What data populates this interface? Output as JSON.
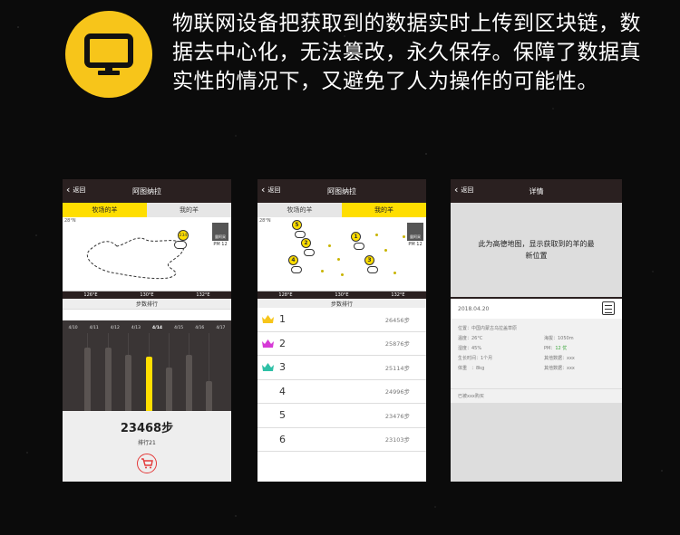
{
  "header": {
    "icon": "monitor-icon",
    "text": "物联网设备把获取到的数据实时上传到区块链，数据去中心化，无法篡改，永久保存。保障了数据真实性的情况下，又避免了人为操作的可能性。"
  },
  "colors": {
    "accent": "#ffde00",
    "dark": "#2a2020",
    "background": "#0b0b0b"
  },
  "phone1": {
    "back": "返回",
    "title": "阿图纳拉",
    "tabs": [
      "牧场的羊",
      "我的羊"
    ],
    "coord_top": "28°N",
    "stat_label": "量阿采",
    "pm": "PM 12",
    "marker": "234",
    "scale": [
      "126°E",
      "130°E",
      "132°E"
    ],
    "rank_title": "步数排行",
    "dates": [
      "4/10",
      "4/11",
      "4/12",
      "4/13",
      "4/14",
      "4/15",
      "4/16",
      "4/17"
    ],
    "selected_date": "4/14",
    "bar_values": [
      0.7,
      0.7,
      0.62,
      0.6,
      0.48,
      0.62,
      0.33
    ],
    "steps": "23468步",
    "rank": "排行21"
  },
  "phone2": {
    "back": "返回",
    "title": "阿图纳拉",
    "tabs": [
      "牧场的羊",
      "我的羊"
    ],
    "coord_top": "28°N",
    "stat_label": "量阿采",
    "pm": "PM 12",
    "markers": [
      "5",
      "2",
      "4",
      "1",
      "3"
    ],
    "scale": [
      "128°E",
      "130°E",
      "132°E"
    ],
    "rank_title": "步数排行",
    "rows": [
      {
        "rank": "1",
        "steps": "26456步",
        "crown": "#f7c51a"
      },
      {
        "rank": "2",
        "steps": "25876步",
        "crown": "#d63ad6"
      },
      {
        "rank": "3",
        "steps": "25114步",
        "crown": "#2ec0a6"
      },
      {
        "rank": "4",
        "steps": "24996步",
        "crown": ""
      },
      {
        "rank": "5",
        "steps": "23476步",
        "crown": ""
      },
      {
        "rank": "6",
        "steps": "23103步",
        "crown": ""
      }
    ]
  },
  "phone3": {
    "back": "返回",
    "title": "详情",
    "map_note": "此为高德地图，显示获取到的羊的最新位置",
    "date": "2018.04.20",
    "info": [
      {
        "l": "位置：中国内蒙古乌拉盖草原",
        "r": ""
      },
      {
        "l": "温度：26°C",
        "r": "海拔：1050m"
      },
      {
        "l": "湿度：45%",
        "r": "PM：12 优"
      },
      {
        "l": "生长时间：1个月",
        "r": "其他数据：xxx"
      },
      {
        "l": "体重　：8kg",
        "r": "其他数据：xxx"
      }
    ],
    "footer": "已被xxx购买"
  }
}
